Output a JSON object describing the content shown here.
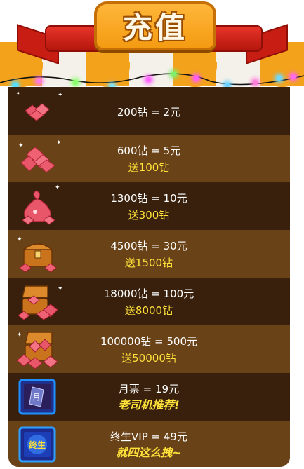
{
  "header": {
    "title": "充值"
  },
  "colors": {
    "stripe_orange": "#f3a21c",
    "stripe_white": "#f4f1ea",
    "board_dark": "#38200d",
    "board_light": "#6a4218",
    "bonus_text": "#ffe23a"
  },
  "lights": [
    "#55e0ff",
    "#ff7be8",
    "#8bff6d",
    "#7be4ff",
    "#ff67ff",
    "#7ff06b",
    "#ff5df2",
    "#6ed2ff",
    "#ff7fd9",
    "#6fd9ff",
    "#ff6bea"
  ],
  "offers": [
    {
      "icon": "diamonds-small-icon",
      "price": "200钻 =  2元",
      "bonus": ""
    },
    {
      "icon": "diamonds-pile-icon",
      "price": "600钻 = 5元",
      "bonus": "送100钻"
    },
    {
      "icon": "diamond-bag-icon",
      "price": "1300钻 = 10元",
      "bonus": "送300钻"
    },
    {
      "icon": "treasure-chest-icon",
      "price": "4500钻 = 30元",
      "bonus": "送1500钻"
    },
    {
      "icon": "open-treasure-chest-icon",
      "price": "18000钻 = 100元",
      "bonus": "送8000钻"
    },
    {
      "icon": "overflowing-treasure-chest-icon",
      "price": "100000钻 = 500元",
      "bonus": "送50000钻"
    },
    {
      "icon": "monthly-pass-card-icon",
      "price": "月票 = 19元",
      "slogan": "老司机推荐!"
    },
    {
      "icon": "lifetime-vip-card-icon",
      "price": "终生VIP = 49元",
      "slogan": "就四这么拽~"
    }
  ]
}
